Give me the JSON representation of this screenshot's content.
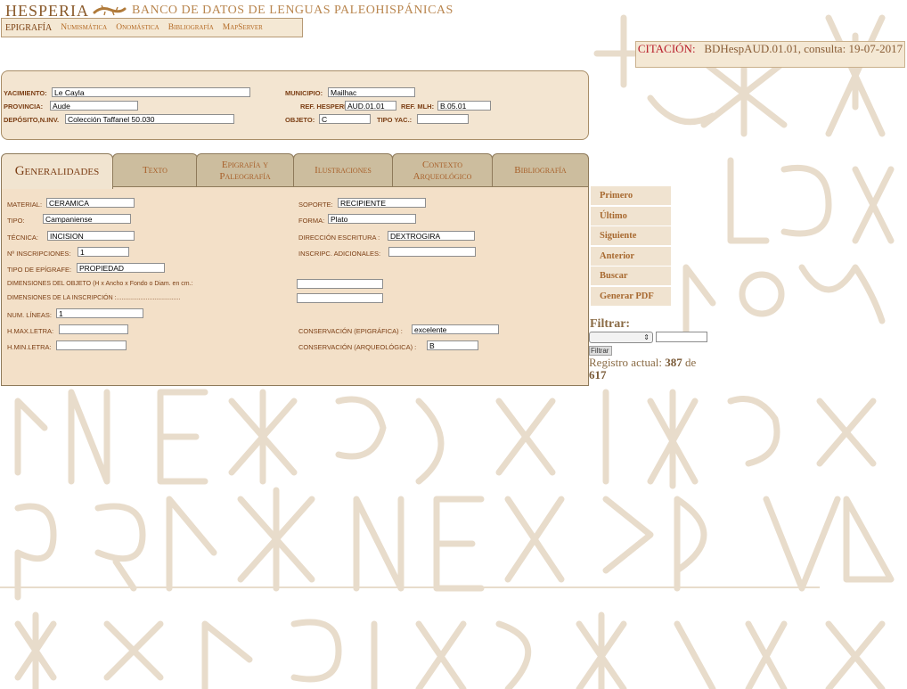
{
  "header": {
    "logo_word": "HESPERIA",
    "subtitle": "BANCO DE DATOS DE LENGUAS PALEOHISPÁNICAS",
    "menu": [
      "EPIGRAFÍA",
      "Numismática",
      "Onomástica",
      "Bibliografía",
      "MapServer"
    ]
  },
  "citation": {
    "label": "CITACIÓN:",
    "value": "BDHespAUD.01.01, consulta: 19-07-2017"
  },
  "info": {
    "yacimiento_label": "YACIMIENTO:",
    "yacimiento": "Le Cayla",
    "municipio_label": "MUNICIPIO:",
    "municipio": "Mailhac",
    "provincia_label": "PROVINCIA:",
    "provincia": "Aude",
    "ref_hesperia_label": "REF. HESPERIA:",
    "ref_hesperia": "AUD.01.01",
    "ref_mlh_label": "REF. MLH:",
    "ref_mlh": "B.05.01",
    "deposito_label": "DEPÓSITO,N.INV.",
    "deposito": "Colección Taffanel 50.030",
    "objeto_label": "OBJETO:",
    "objeto": "C",
    "tipo_yac_label": "TIPO YAC.:",
    "tipo_yac": ""
  },
  "tabs": [
    {
      "label": "Generalidades"
    },
    {
      "label": "Texto"
    },
    {
      "label": "Epigrafía y Paleografía"
    },
    {
      "label": "Ilustraciones"
    },
    {
      "label": "Contexto Arqueológico"
    },
    {
      "label": "Bibliografía"
    }
  ],
  "general": {
    "material_label": "MATERIAL:",
    "material": "CERAMICA",
    "soporte_label": "SOPORTE:",
    "soporte": "RECIPIENTE",
    "tipo_label": "TIPO:",
    "tipo": "Campaniense",
    "forma_label": "FORMA:",
    "forma": "Plato",
    "tecnica_label": "TÉCNICA:",
    "tecnica": "INCISION",
    "direccion_label": "DIRECCIÓN ESCRITURA :",
    "direccion": "DEXTROGIRA",
    "n_inscripciones_label": "Nº INSCRIPCIONES:",
    "n_inscripciones": "1",
    "inscripc_adicionales_label": "INSCRIPC. ADICIONALES:",
    "inscripc_adicionales": "",
    "tipo_epigrafe_label": "TIPO DE EPÍGRAFE:",
    "tipo_epigrafe": "PROPIEDAD",
    "dim_objeto_label": "DIMENSIONES DEL OBJETO (H x Ancho x Fondo o Diam. en cm.:",
    "dim_objeto": "",
    "dim_inscripcion_label": "DIMENSIONES DE LA INSCRIPCIÓN :.....................................",
    "dim_inscripcion": "",
    "num_lineas_label": "NUM. LÍNEAS:",
    "num_lineas": "1",
    "hmax_label": "H.MAX.LETRA:",
    "hmax": "",
    "conservacion_epi_label": "CONSERVACIÓN (EPIGRÁFICA) :",
    "conservacion_epi": "excelente",
    "hmin_label": "H.MIN.LETRA:",
    "hmin": "",
    "conservacion_arq_label": "CONSERVACIÓN (ARQUEOLÓGICA) :",
    "conservacion_arq": "B"
  },
  "nav": [
    "Primero",
    "Último",
    "Siguiente",
    "Anterior",
    "Buscar",
    "Generar PDF"
  ],
  "filter": {
    "label": "Filtrar:",
    "select_value": "",
    "text": "",
    "button": "Filtrar"
  },
  "registro": {
    "prefix": "Registro actual:",
    "current": "387",
    "mid": "de",
    "total": "617"
  }
}
